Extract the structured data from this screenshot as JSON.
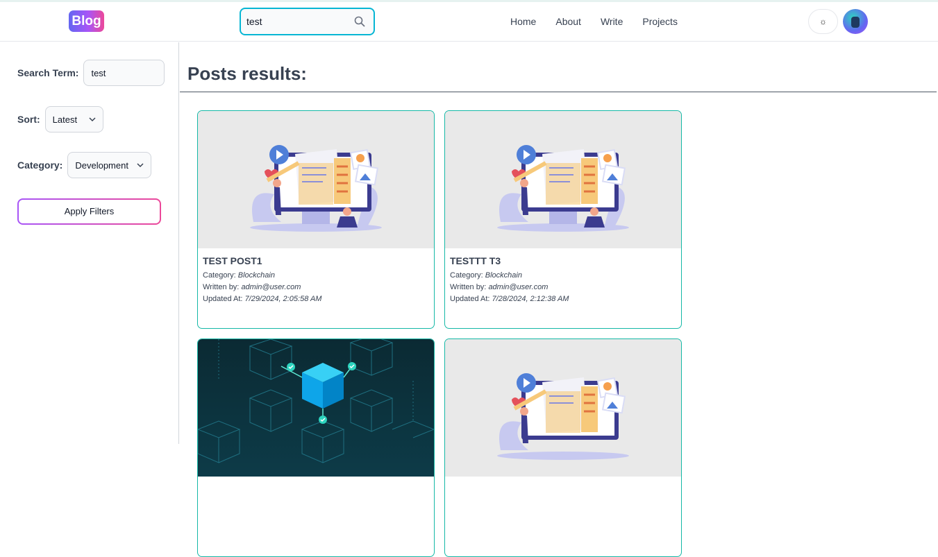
{
  "header": {
    "logo": "Blog",
    "search_value": "test",
    "nav": [
      "Home",
      "About",
      "Write",
      "Projects"
    ],
    "theme_icon": "☼",
    "avatar_initial": "S"
  },
  "sidebar": {
    "search_term_label": "Search Term:",
    "search_term_value": "test",
    "sort_label": "Sort:",
    "sort_value": "Latest",
    "category_label": "Category:",
    "category_value": "Development",
    "apply_label": "Apply Filters"
  },
  "main": {
    "title": "Posts results:",
    "posts": [
      {
        "title": "TEST POST1",
        "category_label": "Category:",
        "category": "Blockchain",
        "author_label": "Written by:",
        "author": "admin@user.com",
        "updated_label": "Updated At:",
        "updated": "7/29/2024, 2:05:58 AM",
        "image": "blog-illustration"
      },
      {
        "title": "TESTTT T3",
        "category_label": "Category:",
        "category": "Blockchain",
        "author_label": "Written by:",
        "author": "admin@user.com",
        "updated_label": "Updated At:",
        "updated": "7/28/2024, 2:12:38 AM",
        "image": "blog-illustration"
      },
      {
        "image": "blockchain-cubes"
      },
      {
        "image": "blog-illustration"
      }
    ]
  },
  "colors": {
    "accent": "#06b6d4",
    "card_border": "#14b8a6",
    "gradient_start": "#a855f7",
    "gradient_end": "#ec4899"
  }
}
